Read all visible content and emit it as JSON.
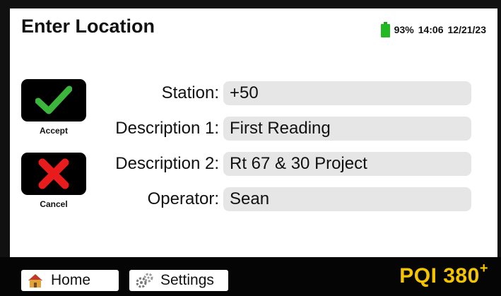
{
  "header": {
    "title": "Enter Location",
    "battery_percent": "93%",
    "time": "14:06",
    "date": "12/21/23",
    "battery_color": "#22b822"
  },
  "actions": {
    "accept_label": "Accept",
    "cancel_label": "Cancel",
    "accept_icon": "checkmark-icon",
    "cancel_icon": "x-icon"
  },
  "fields": [
    {
      "label": "Station:",
      "value": "+50"
    },
    {
      "label": "Description 1:",
      "value": "First Reading"
    },
    {
      "label": "Description 2:",
      "value": "Rt 67 & 30 Project"
    },
    {
      "label": "Operator:",
      "value": "Sean"
    }
  ],
  "nav": {
    "home_label": "Home",
    "settings_label": "Settings"
  },
  "brand": {
    "name": "PQI 380",
    "suffix": "+",
    "color": "#f5c400"
  }
}
